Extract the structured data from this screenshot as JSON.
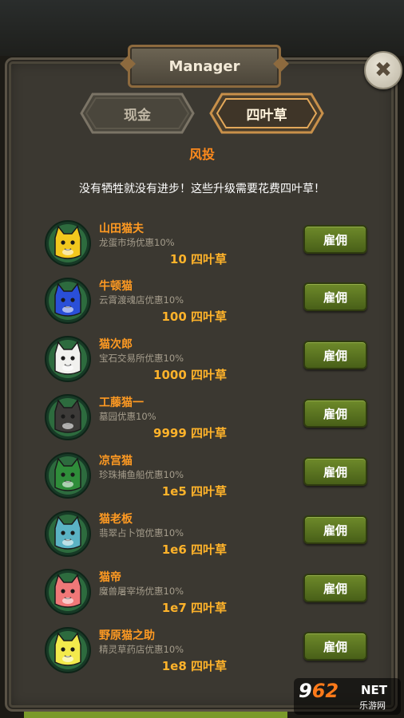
{
  "window": {
    "title": "Manager",
    "close_symbol": "✖"
  },
  "tabs": [
    {
      "label": "现金",
      "active": false
    },
    {
      "label": "四叶草",
      "active": true
    }
  ],
  "section": {
    "title": "风投",
    "subtitle": "没有牺牲就没有进步！这些升级需要花费四叶草！"
  },
  "managers": [
    {
      "name": "山田猫夫",
      "desc": "龙蛋市场优惠10%",
      "cost": "10 四叶草",
      "hire": "雇佣",
      "color": "#f2c81e"
    },
    {
      "name": "牛顿猫",
      "desc": "云霄渡魂店优惠10%",
      "cost": "100 四叶草",
      "hire": "雇佣",
      "color": "#2a4fd8"
    },
    {
      "name": "猫次郎",
      "desc": "宝石交易所优惠10%",
      "cost": "1000 四叶草",
      "hire": "雇佣",
      "color": "#f1f1ee"
    },
    {
      "name": "工藤猫一",
      "desc": "墓园优惠10%",
      "cost": "9999 四叶草",
      "hire": "雇佣",
      "color": "#3c3a38"
    },
    {
      "name": "凉宫猫",
      "desc": "珍珠捕鱼船优惠10%",
      "cost": "1e5 四叶草",
      "hire": "雇佣",
      "color": "#2f8d3a"
    },
    {
      "name": "猫老板",
      "desc": "翡翠占卜馆优惠10%",
      "cost": "1e6 四叶草",
      "hire": "雇佣",
      "color": "#5bb3c4"
    },
    {
      "name": "猫帝",
      "desc": "魔兽屠宰场优惠10%",
      "cost": "1e7 四叶草",
      "hire": "雇佣",
      "color": "#f07878"
    },
    {
      "name": "野原猫之助",
      "desc": "精灵草药店优惠10%",
      "cost": "1e8 四叶草",
      "hire": "雇佣",
      "color": "#f3ea4c"
    }
  ],
  "watermark": {
    "main_a": "9",
    "main_b": "62",
    "net": "NET",
    "sub": "乐游网"
  }
}
